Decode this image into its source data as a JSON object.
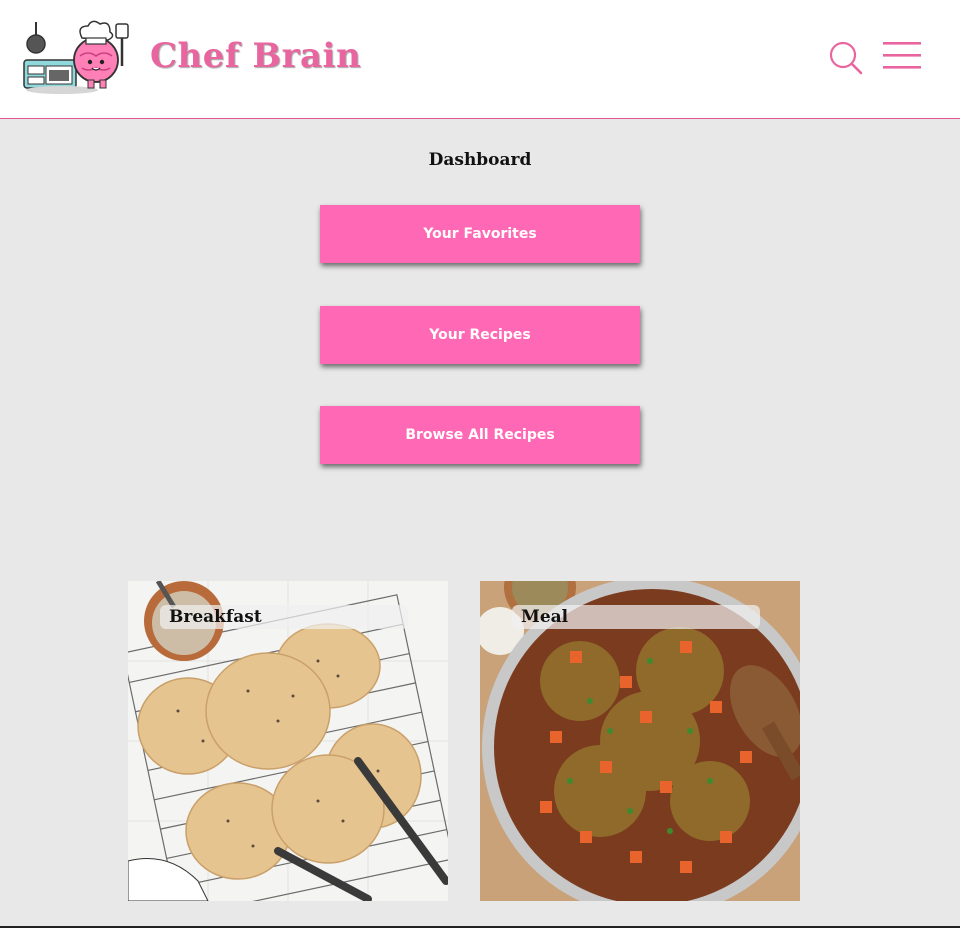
{
  "header": {
    "brand": "Chef Brain",
    "search_icon": "search-icon",
    "menu_icon": "hamburger-menu-icon",
    "accent_color": "#e9659f"
  },
  "dashboard": {
    "title": "Dashboard",
    "buttons": [
      {
        "label": "Your Favorites"
      },
      {
        "label": "Your Recipes"
      },
      {
        "label": "Browse All Recipes"
      }
    ],
    "button_color": "#ff68b4"
  },
  "categories": [
    {
      "label": "Breakfast"
    },
    {
      "label": "Meal"
    }
  ]
}
